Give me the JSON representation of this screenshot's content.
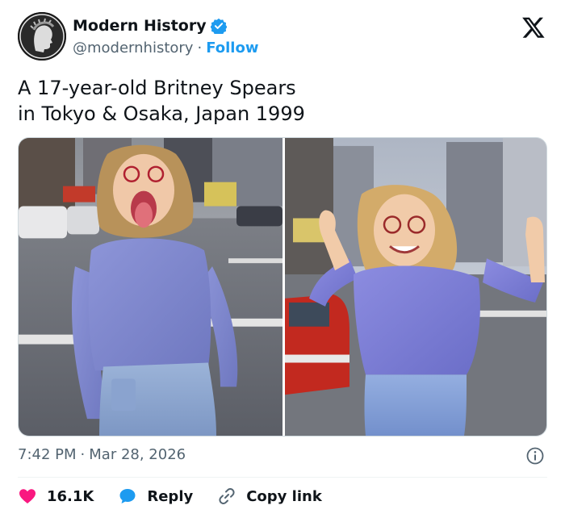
{
  "author": {
    "name": "Modern History",
    "handle": "@modernhistory",
    "separator": "·",
    "follow_label": "Follow",
    "verified": true,
    "avatar_icon": "laurel-bust-avatar"
  },
  "platform_icon": "x-logo-icon",
  "tweet": {
    "text_line1": "A 17-year-old Britney Spears",
    "text_line2": "in Tokyo & Osaka, Japan 1999"
  },
  "timestamp": {
    "time": "7:42 PM",
    "separator": "·",
    "date": "Mar 28, 2026"
  },
  "actions": {
    "likes_count": "16.1K",
    "reply_label": "Reply",
    "copy_link_label": "Copy link"
  },
  "colors": {
    "accent": "#1d9bf0",
    "like": "#f91880",
    "text": "#0f1419",
    "muted": "#536471"
  }
}
